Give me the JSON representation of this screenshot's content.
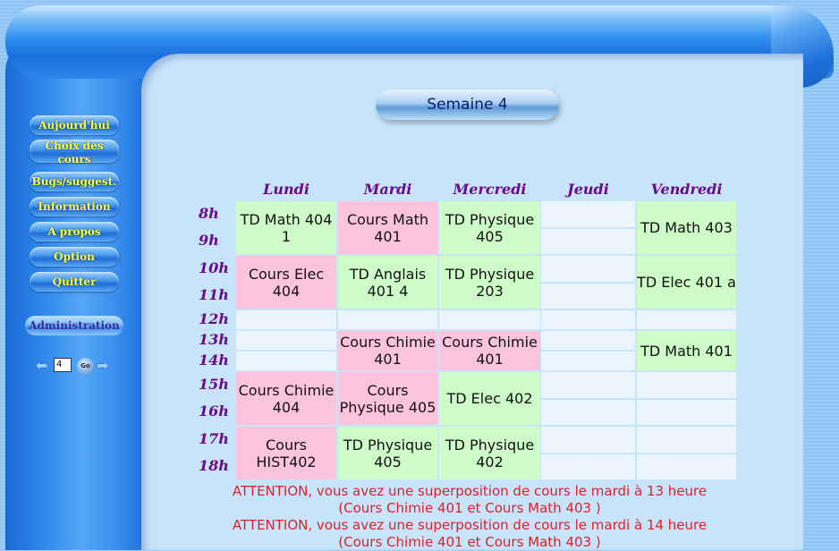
{
  "week_title": "Semaine 4",
  "sidebar": {
    "items": [
      {
        "label": "Aujourd'hui"
      },
      {
        "label": "Choix des cours"
      },
      {
        "label": "Bugs/suggest."
      },
      {
        "label": "Information"
      },
      {
        "label": "A propos"
      },
      {
        "label": "Option"
      },
      {
        "label": "Quitter"
      }
    ],
    "admin_label": "Administration",
    "week_input_value": "4",
    "go_label": "Go"
  },
  "schedule": {
    "days": [
      "Lundi",
      "Mardi",
      "Mercredi",
      "Jeudi",
      "Vendredi"
    ],
    "hours": [
      "8h",
      "9h",
      "10h",
      "11h",
      "12h",
      "13h",
      "14h",
      "15h",
      "16h",
      "17h",
      "18h"
    ],
    "courses": {
      "lun_8": "TD Math 404 1",
      "mar_8": "Cours Math 401",
      "mer_8": "TD Physique 405",
      "ven_8": "TD Math 403",
      "lun_10": "Cours Elec 404",
      "mar_10": "TD Anglais 401 4",
      "mer_10": "TD Physique 203",
      "ven_10": "TD Elec 401 a",
      "mar_13": "Cours Chimie 401",
      "mer_13": "Cours Chimie 401",
      "ven_13": "TD Math 401",
      "lun_15": "Cours Chimie 404",
      "mar_15": "Cours Physique 405",
      "mer_15": "TD Elec 402",
      "lun_17": "Cours HIST402",
      "mar_17": "TD Physique 405",
      "mer_17": "TD Physique 402"
    },
    "colors": {
      "pink": "#fcc4dc",
      "green": "#cefcc8",
      "empty": "#eaf4fd",
      "day_header": "#6a0a8a"
    }
  },
  "warnings": [
    "ATTENTION, vous avez une superposition de cours le mardi à 13 heure",
    "(Cours Chimie 401 et Cours Math 403 )",
    "ATTENTION, vous avez une superposition de cours le mardi à 14 heure",
    "(Cours Chimie 401 et Cours Math 403 )"
  ]
}
